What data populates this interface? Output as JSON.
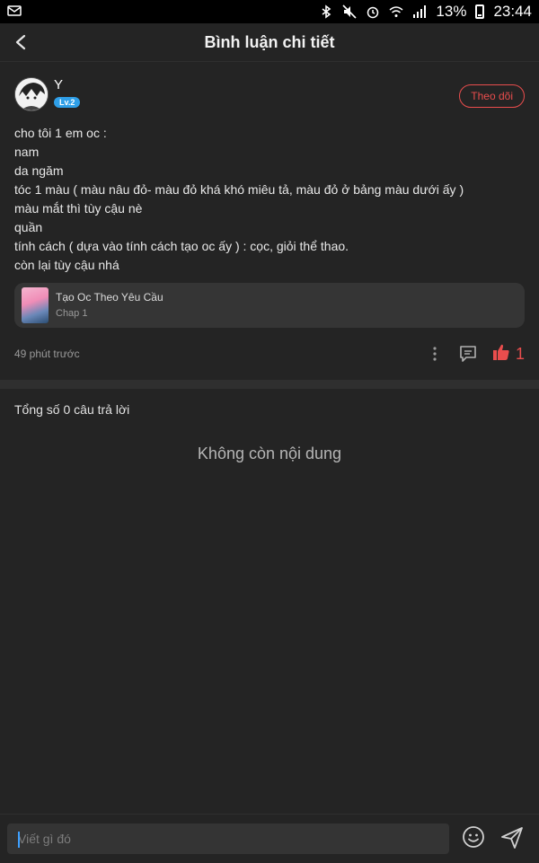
{
  "statusbar": {
    "battery": "13%",
    "time": "23:44"
  },
  "header": {
    "title": "Bình luận chi tiết"
  },
  "comment": {
    "username": "Y",
    "level": "Lv.2",
    "follow_label": "Theo dõi",
    "lines": [
      "cho tôi 1 em oc :",
      "nam",
      "da ngăm",
      "tóc 1 màu ( màu nâu đỏ- màu đỏ khá khó miêu tả, màu đỏ ở bảng màu dưới ấy )",
      "màu mắt thì tùy cậu nè",
      "quần",
      "tính cách ( dựa vào tính cách tạo oc ấy ) : cọc, giỏi thể thao.",
      "còn lại tùy cậu nhá"
    ],
    "book": {
      "title": "Tạo Oc Theo Yêu Cầu",
      "chapter": "Chap 1"
    },
    "time": "49 phút trước",
    "likes": "1"
  },
  "replies": {
    "count_label": "Tổng số 0 câu trả lời",
    "empty_label": "Không còn nội dung"
  },
  "composer": {
    "placeholder": "Viết gì đó"
  },
  "colors": {
    "background": "#242424",
    "accent": "#ea4d4d",
    "level_badge": "#2f9fe8"
  },
  "icons": [
    "mail-icon",
    "bluetooth-icon",
    "mute-icon",
    "alarm-icon",
    "wifi-icon",
    "signal-icon",
    "battery-icon",
    "back-arrow-icon",
    "more-vertical-icon",
    "reply-comment-icon",
    "thumbs-up-icon",
    "emoji-icon",
    "send-icon"
  ]
}
